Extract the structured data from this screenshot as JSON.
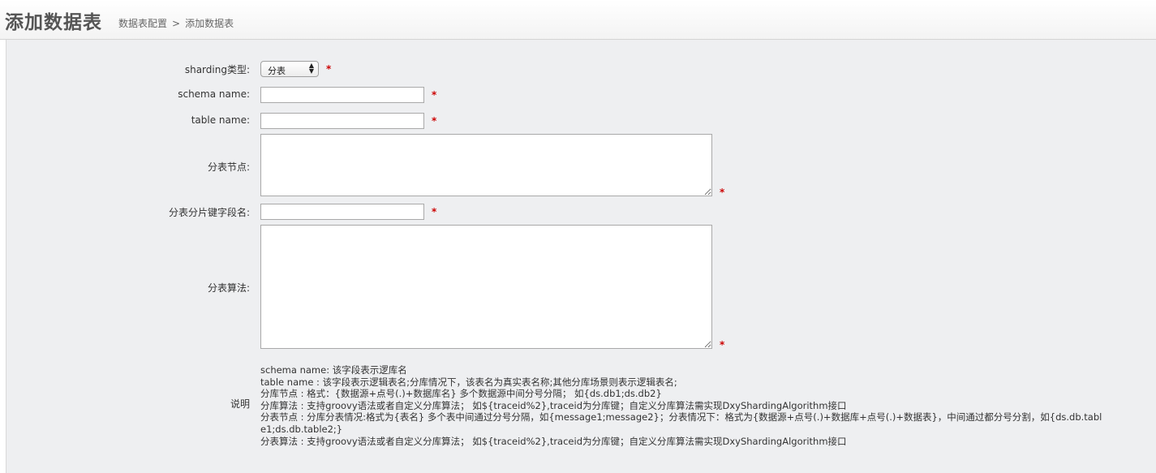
{
  "header": {
    "title": "添加数据表",
    "breadcrumb": {
      "parent": "数据表配置",
      "separator": ">",
      "current": "添加数据表"
    }
  },
  "form": {
    "required_mark": "*",
    "sharding_type": {
      "label": "sharding类型:",
      "value": "分表"
    },
    "schema_name": {
      "label": "schema name:",
      "value": ""
    },
    "table_name": {
      "label": "table name:",
      "value": ""
    },
    "table_nodes": {
      "label": "分表节点:",
      "value": ""
    },
    "shard_key": {
      "label": "分表分片键字段名:",
      "value": ""
    },
    "algorithm": {
      "label": "分表算法:",
      "value": ""
    },
    "description": {
      "label": "说明",
      "lines": [
        "schema name: 该字段表示逻库名",
        "table name : 该字段表示逻辑表名;分库情况下，该表名为真实表名称;其他分库场景则表示逻辑表名;",
        "分库节点 : 格式：{数据源+点号(.)+数据库名} 多个数据源中间分号分隔；  如{ds.db1;ds.db2}",
        "分库算法 : 支持groovy语法或者自定义分库算法；  如${traceid%2},traceid为分库键；自定义分库算法需实现DxyShardingAlgorithm接口",
        "分表节点 : 分库分表情况:格式为{表名} 多个表中间通过分号分隔，如{message1;message2}；分表情况下：格式为{数据源+点号(.)+数据库+点号(.)+数据表}，中间通过都分号分割，如{ds.db.tabl",
        "e1;ds.db.table2;}",
        "分表算法 : 支持groovy语法或者自定义分库算法；  如${traceid%2},traceid为分库键；自定义分库算法需实现DxyShardingAlgorithm接口"
      ]
    }
  }
}
